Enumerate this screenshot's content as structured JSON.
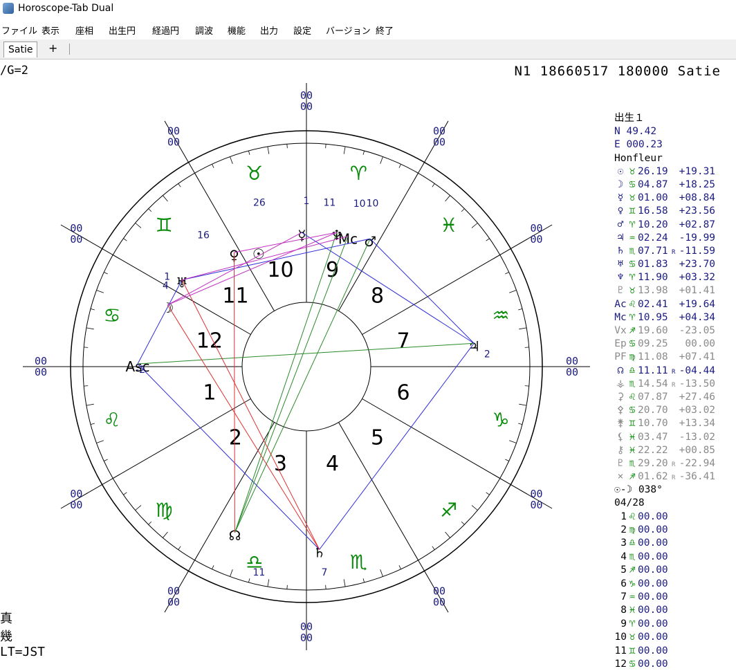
{
  "window": {
    "title": "Horoscope-Tab Dual"
  },
  "menu": [
    "ファイル",
    "表示",
    "座相",
    "出生円",
    "経過円",
    "調波",
    "機能",
    "出力",
    "設定",
    "バージョン",
    "終了"
  ],
  "tabs": {
    "active": "Satie",
    "add": "+"
  },
  "header": {
    "left": "/G=2",
    "right": "N1 18660517 180000  Satie"
  },
  "footer": [
    "真",
    "幾",
    "LT=JST"
  ],
  "colors": {
    "sign_glyph": "#0a8a0a",
    "house_number": "#000000",
    "degree_label": "#1a1a80",
    "aspect_blue": "#2d2dd8",
    "aspect_red": "#e03030",
    "aspect_green": "#2a8a2a",
    "aspect_magenta": "#c030c0"
  },
  "chart": {
    "outer_double_zero": "00",
    "signs": [
      "♉",
      "♈",
      "♓",
      "♒",
      "♑",
      "♐",
      "♏",
      "♎",
      "♍",
      "♌",
      "♋",
      "♊"
    ],
    "house_numbers": [
      "1",
      "2",
      "3",
      "4",
      "5",
      "6",
      "7",
      "8",
      "9",
      "10",
      "11",
      "12"
    ],
    "cusp_labels": [
      "26",
      "16",
      "1",
      "4",
      "-2",
      "2",
      "7",
      "11",
      "11",
      "10",
      "10",
      "1"
    ],
    "planets": [
      {
        "glyph": "☿",
        "name": "Mercury"
      },
      {
        "glyph": "♆",
        "name": "Neptune"
      },
      {
        "glyph": "Mc",
        "name": "MC"
      },
      {
        "glyph": "♂",
        "name": "Mars"
      },
      {
        "glyph": "☉",
        "name": "Sun"
      },
      {
        "glyph": "♀",
        "name": "Venus"
      },
      {
        "glyph": "♅",
        "name": "Uranus"
      },
      {
        "glyph": "☽",
        "name": "Moon"
      },
      {
        "glyph": "Asc",
        "name": "Asc"
      },
      {
        "glyph": "♃",
        "name": "Jupiter"
      },
      {
        "glyph": "☊",
        "name": "Node"
      },
      {
        "glyph": "♄",
        "name": "Saturn"
      }
    ]
  },
  "panel": {
    "heading": "出生１",
    "lat": "N  49.42",
    "lon": "E 000.23",
    "place": "Honfleur",
    "rows": [
      {
        "sym": "☉",
        "sign": "♉",
        "deg": "26.19",
        "r": "",
        "dec": "+19.31",
        "tone": "navy"
      },
      {
        "sym": "☽",
        "sign": "♋",
        "deg": "04.87",
        "r": "",
        "dec": "+18.25",
        "tone": "navy"
      },
      {
        "sym": "☿",
        "sign": "♉",
        "deg": "01.00",
        "r": "",
        "dec": "+08.84",
        "tone": "navy"
      },
      {
        "sym": "♀",
        "sign": "♊",
        "deg": "16.58",
        "r": "",
        "dec": "+23.56",
        "tone": "navy"
      },
      {
        "sym": "♂",
        "sign": "♈",
        "deg": "10.20",
        "r": "",
        "dec": "+02.87",
        "tone": "navy"
      },
      {
        "sym": "♃",
        "sign": "♒",
        "deg": "02.24",
        "r": "",
        "dec": "-19.99",
        "tone": "navy"
      },
      {
        "sym": "♄",
        "sign": "♏",
        "deg": "07.71",
        "r": "R",
        "dec": "-11.59",
        "tone": "navy"
      },
      {
        "sym": "♅",
        "sign": "♋",
        "deg": "01.83",
        "r": "",
        "dec": "+23.70",
        "tone": "navy"
      },
      {
        "sym": "♆",
        "sign": "♈",
        "deg": "11.90",
        "r": "",
        "dec": "+03.32",
        "tone": "navy"
      },
      {
        "sym": "♇",
        "sign": "♉",
        "deg": "13.98",
        "r": "",
        "dec": "+01.41",
        "tone": "grey"
      },
      {
        "sym": "Ac",
        "sign": "♌",
        "deg": "02.41",
        "r": "",
        "dec": "+19.64",
        "tone": "navy"
      },
      {
        "sym": "Mc",
        "sign": "♈",
        "deg": "10.95",
        "r": "",
        "dec": "+04.34",
        "tone": "navy"
      },
      {
        "sym": "Vx",
        "sign": "♐",
        "deg": "19.60",
        "r": "",
        "dec": "-23.05",
        "tone": "grey"
      },
      {
        "sym": "Ep",
        "sign": "♋",
        "deg": "09.25",
        "r": "",
        "dec": " 00.00",
        "tone": "grey"
      },
      {
        "sym": "PF",
        "sign": "♍",
        "deg": "11.08",
        "r": "",
        "dec": "+07.41",
        "tone": "grey"
      },
      {
        "sym": "☊",
        "sign": "♎",
        "deg": "11.11",
        "r": "R",
        "dec": "-04.44",
        "tone": "navy"
      },
      {
        "sym": "⚶",
        "sign": "♏",
        "deg": "14.54",
        "r": "R",
        "dec": "-13.50",
        "tone": "grey"
      },
      {
        "sym": "⚳",
        "sign": "♌",
        "deg": "07.87",
        "r": "",
        "dec": "+27.46",
        "tone": "grey"
      },
      {
        "sym": "⚴",
        "sign": "♋",
        "deg": "20.70",
        "r": "",
        "dec": "+03.02",
        "tone": "grey"
      },
      {
        "sym": "⚵",
        "sign": "♊",
        "deg": "10.70",
        "r": "",
        "dec": "+13.34",
        "tone": "grey"
      },
      {
        "sym": "⚸",
        "sign": "♓",
        "deg": "03.47",
        "r": "",
        "dec": "-13.02",
        "tone": "grey"
      },
      {
        "sym": "⚷",
        "sign": "♓",
        "deg": "22.22",
        "r": "",
        "dec": "+00.85",
        "tone": "grey"
      },
      {
        "sym": "♇",
        "sign": "♏",
        "deg": "29.20",
        "r": "R",
        "dec": "-22.94",
        "tone": "grey"
      },
      {
        "sym": "⨯",
        "sign": "♐",
        "deg": "01.62",
        "r": "R",
        "dec": "-36.41",
        "tone": "grey"
      }
    ],
    "sunmoon": "☉-☽ 038°",
    "phase": "04/28",
    "cusps": [
      {
        "n": "1",
        "sign": "♌",
        "deg": "00.00"
      },
      {
        "n": "2",
        "sign": "♍",
        "deg": "00.00"
      },
      {
        "n": "3",
        "sign": "♎",
        "deg": "00.00"
      },
      {
        "n": "4",
        "sign": "♏",
        "deg": "00.00"
      },
      {
        "n": "5",
        "sign": "♐",
        "deg": "00.00"
      },
      {
        "n": "6",
        "sign": "♑",
        "deg": "00.00"
      },
      {
        "n": "7",
        "sign": "♒",
        "deg": "00.00"
      },
      {
        "n": "8",
        "sign": "♓",
        "deg": "00.00"
      },
      {
        "n": "9",
        "sign": "♈",
        "deg": "00.00"
      },
      {
        "n": "10",
        "sign": "♉",
        "deg": "00.00"
      },
      {
        "n": "11",
        "sign": "♊",
        "deg": "00.00"
      },
      {
        "n": "12",
        "sign": "♋",
        "deg": "00.00"
      }
    ]
  }
}
